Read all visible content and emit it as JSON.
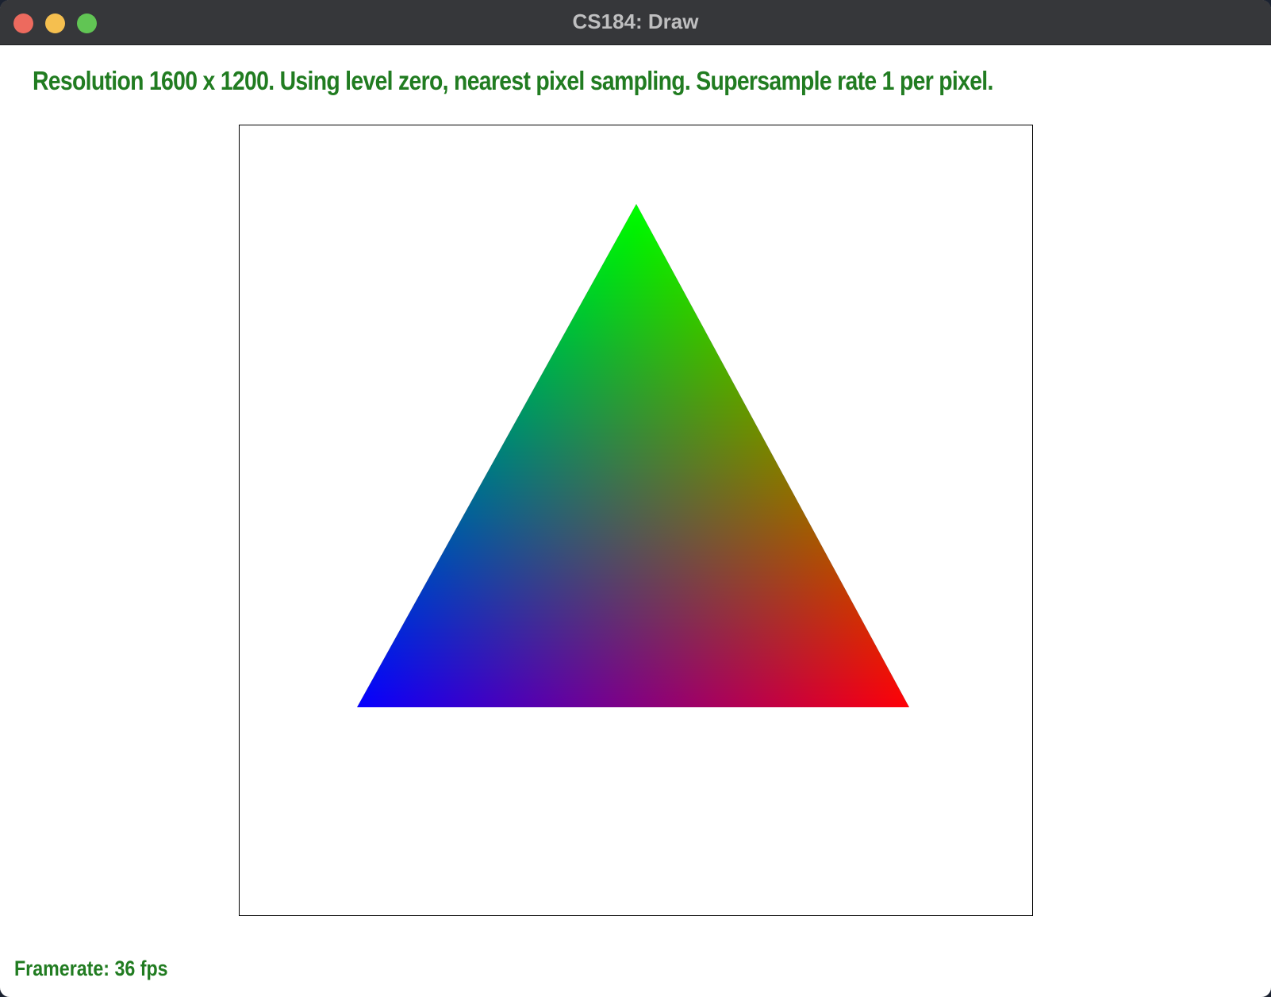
{
  "window": {
    "title": "CS184: Draw"
  },
  "status": {
    "text": "Resolution 1600 x 1200. Using level zero, nearest pixel sampling. Supersample rate 1 per pixel.",
    "color": "#217c21"
  },
  "triangle": {
    "top_color": "#00ff00",
    "left_color": "#0000ff",
    "right_color": "#ff0000"
  },
  "footer": {
    "framerate_text": "Framerate: 36 fps"
  }
}
